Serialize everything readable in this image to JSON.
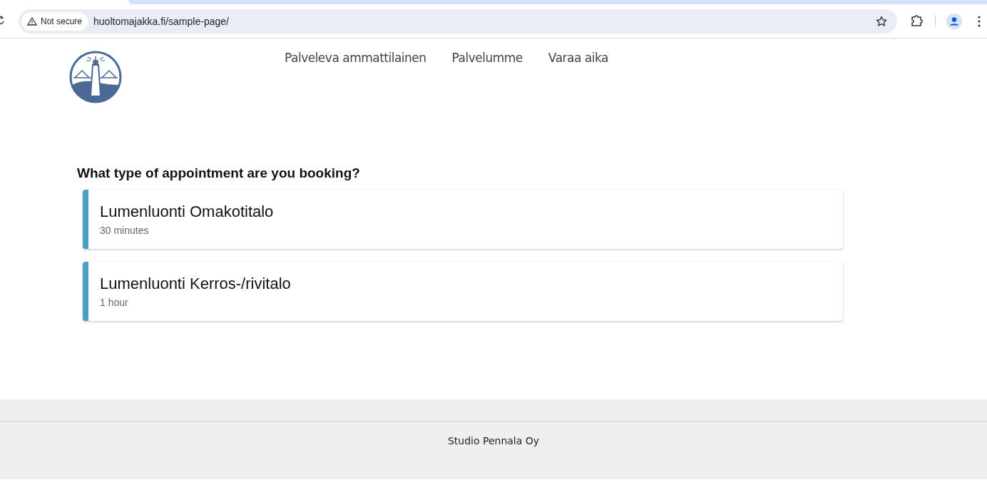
{
  "browser": {
    "security": "Not secure",
    "url": "huoltomajakka.fi/sample-page/"
  },
  "nav": [
    {
      "label": "Palveleva ammattilainen"
    },
    {
      "label": "Palvelumme"
    },
    {
      "label": "Varaa aika"
    }
  ],
  "heading": "What type of appointment are you booking?",
  "appointments": [
    {
      "title": "Lumenluonti Omakotitalo",
      "duration": "30 minutes",
      "color": "#4a9fc4"
    },
    {
      "title": "Lumenluonti Kerros-/rivitalo",
      "duration": "1 hour",
      "color": "#4a9fc4"
    }
  ],
  "footer": "Studio Pennala Oy"
}
